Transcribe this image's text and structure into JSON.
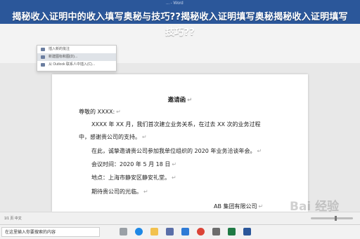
{
  "window": {
    "title": "... - Word"
  },
  "headline": {
    "line1": "揭秘收入证明中的收入填写奥秘与技巧??揭秘收入证明填写奥秘揭秘收入证明填写",
    "line2": "技巧??"
  },
  "menu": {
    "items": [
      "插入新的批注",
      "新建图标和图(D)...",
      "从 Outlook 联系人中插入(C)..."
    ]
  },
  "document": {
    "title": "邀请函",
    "paragraph_mark": "↵",
    "lines": [
      "尊敬的 XXXX:",
      "XXXX 年 XX 月，我们首次建立业务关系，在过去 XX 次的业务过程",
      "中，感谢贵公司的支持。",
      "在此，诚挚邀请贵公司参加我单位组织的 2020 年业务洽谈年会。",
      "会议时间：2020 年 5 月 18 日",
      "地点：上海市静安区静安礼堂。",
      "期待贵公司的光临。",
      "AB 集团有限公司"
    ]
  },
  "statusbar": {
    "pages": "1/1 页 中文"
  },
  "watermark": "Bai 经验",
  "taskbar": {
    "search_text": "在这里输入你要搜索的内容",
    "icons": [
      "task-view-icon",
      "edge-icon",
      "file-explorer-icon",
      "store-icon",
      "mail-icon",
      "chrome-icon",
      "app-icon",
      "excel-icon",
      "word-icon"
    ]
  },
  "colors": {
    "word_blue": "#2b579a",
    "page": "#ffffff"
  }
}
